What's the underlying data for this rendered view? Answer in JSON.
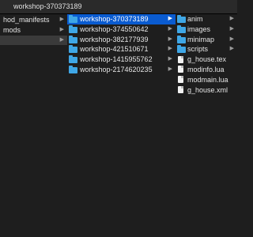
{
  "window": {
    "title": "workshop-370373189"
  },
  "column1": {
    "items": [
      {
        "label": "hod_manifests",
        "chevron": "▶"
      },
      {
        "label": "mods",
        "chevron": "▶"
      },
      {
        "label": "",
        "chevron": "▶"
      }
    ]
  },
  "column2": {
    "items": [
      {
        "label": "workshop-370373189",
        "chevron": "▶"
      },
      {
        "label": "workshop-374550642",
        "chevron": "▶"
      },
      {
        "label": "workshop-382177939",
        "chevron": "▶"
      },
      {
        "label": "workshop-421510671",
        "chevron": "▶"
      },
      {
        "label": "workshop-1415955762",
        "chevron": "▶"
      },
      {
        "label": "workshop-2174620235",
        "chevron": "▶"
      }
    ]
  },
  "column3": {
    "items": [
      {
        "label": "anim",
        "chevron": "▶",
        "icon": "folder-icon"
      },
      {
        "label": "images",
        "chevron": "▶",
        "icon": "folder-icon"
      },
      {
        "label": "minimap",
        "chevron": "▶",
        "icon": "folder-icon"
      },
      {
        "label": "scripts",
        "chevron": "▶",
        "icon": "folder-icon"
      },
      {
        "label": "g_house.tex",
        "icon": "document-icon"
      },
      {
        "label": "modinfo.lua",
        "icon": "document-icon"
      },
      {
        "label": "modmain.lua",
        "icon": "document-icon"
      },
      {
        "label": "g_house.xml",
        "icon": "document-icon"
      }
    ]
  },
  "colors": {
    "selection": "#0a5bd0",
    "folder": "#3fa7e6",
    "background": "#1e1e1e"
  }
}
